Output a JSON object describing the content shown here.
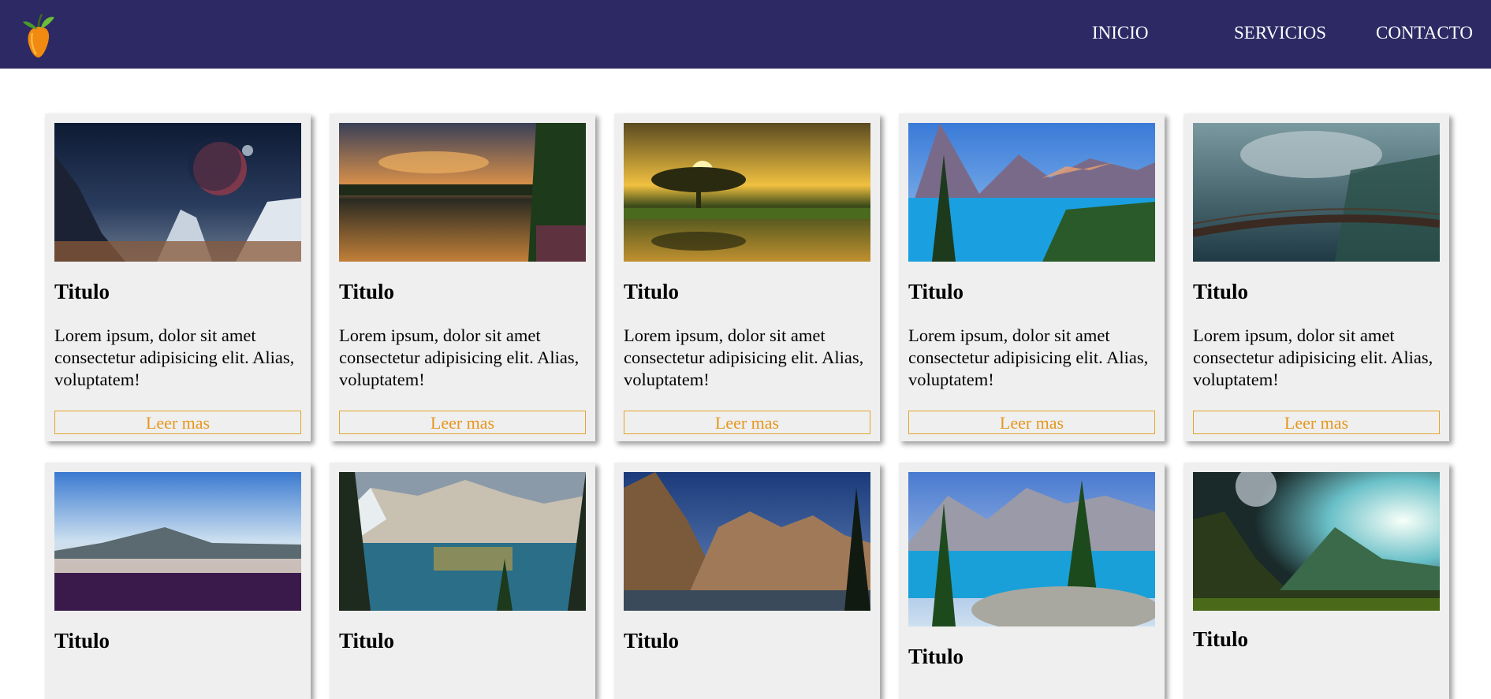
{
  "header": {
    "logo_icon": "fruit-logo-icon",
    "nav": [
      {
        "label": "INICIO"
      },
      {
        "label": "SERVICIOS"
      },
      {
        "label": "CONTACTO"
      }
    ]
  },
  "cards": [
    {
      "image": "space-planet-landscape",
      "title": "Titulo",
      "text": "Lorem ipsum, dolor sit amet consectetur adipisicing elit. Alias, voluptatem!",
      "button": "Leer mas"
    },
    {
      "image": "sunset-lake-reflection",
      "title": "Titulo",
      "text": "Lorem ipsum, dolor sit amet consectetur adipisicing elit. Alias, voluptatem!",
      "button": "Leer mas"
    },
    {
      "image": "golden-tree-sunset",
      "title": "Titulo",
      "text": "Lorem ipsum, dolor sit amet consectetur adipisicing elit. Alias, voluptatem!",
      "button": "Leer mas"
    },
    {
      "image": "blue-mountain-lake",
      "title": "Titulo",
      "text": "Lorem ipsum, dolor sit amet consectetur adipisicing elit. Alias, voluptatem!",
      "button": "Leer mas"
    },
    {
      "image": "misty-forest-bridge",
      "title": "Titulo",
      "text": "Lorem ipsum, dolor sit amet consectetur adipisicing elit. Alias, voluptatem!",
      "button": "Leer mas"
    },
    {
      "image": "lavender-field-mountain",
      "title": "Titulo"
    },
    {
      "image": "canyon-lake-reflection",
      "title": "Titulo"
    },
    {
      "image": "rocky-mountain-sunrise",
      "title": "Titulo"
    },
    {
      "image": "pine-lake-rocks",
      "title": "Titulo"
    },
    {
      "image": "fantasy-valley-moon",
      "title": "Titulo"
    }
  ],
  "colors": {
    "header_bg": "#2c2965",
    "card_bg": "#efefef",
    "accent": "#e6971f"
  }
}
